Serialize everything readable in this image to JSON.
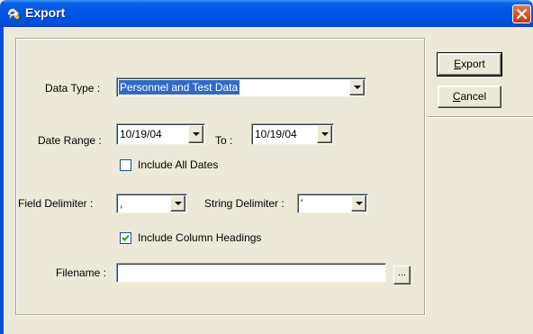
{
  "window": {
    "title": "Export",
    "close_icon": "close-icon"
  },
  "form": {
    "data_type": {
      "label": "Data Type :",
      "value": "Personnel and Test Data"
    },
    "date_range": {
      "label": "Date Range :",
      "from_value": "10/19/04",
      "to_label": "To :",
      "to_value": "10/19/04"
    },
    "include_all_dates": {
      "label": "Include All Dates",
      "checked": false
    },
    "field_delimiter": {
      "label": "Field Delimiter :",
      "value": ","
    },
    "string_delimiter": {
      "label": "String Delimiter :",
      "value": "'"
    },
    "include_column_headings": {
      "label": "Include Column Headings",
      "checked": true
    },
    "filename": {
      "label": "Filename :",
      "value": "",
      "browse_label": "..."
    }
  },
  "buttons": {
    "export": {
      "label_underlined": "E",
      "label_rest": "xport"
    },
    "cancel": {
      "label_underlined": "C",
      "label_rest": "ancel"
    }
  },
  "colors": {
    "titlebar": "#0054e3",
    "face": "#ece9d8",
    "selection": "#316ac5",
    "close": "#c23b11"
  }
}
